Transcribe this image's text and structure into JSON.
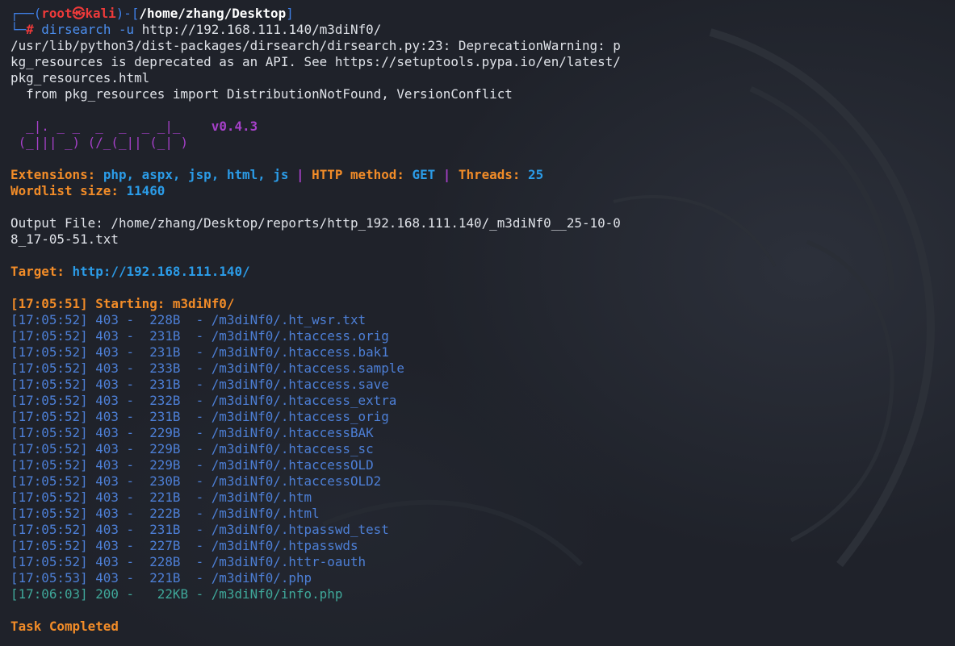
{
  "prompt": {
    "frame_top": "┌──(",
    "user": "root㉿kali",
    "frame_mid": ")-[",
    "cwd": "/home/zhang/Desktop",
    "frame_end": "]",
    "frame_bottom": "└─",
    "hash": "#",
    "command": "dirsearch",
    "args": "-u",
    "url": "http://192.168.111.140/m3diNf0/"
  },
  "warning": {
    "line1": "/usr/lib/python3/dist-packages/dirsearch/dirsearch.py:23: DeprecationWarning: p",
    "line2": "kg_resources is deprecated as an API. See https://setuptools.pypa.io/en/latest/",
    "line3": "pkg_resources.html",
    "line4": "  from pkg_resources import DistributionNotFound, VersionConflict"
  },
  "banner": {
    "art1": "  _|. _ _  _  _  _ _|_    ",
    "version": "v0.4.3",
    "art2": " (_||| _) (/_(_|| (_| )"
  },
  "config": {
    "ext_label": "Extensions: ",
    "ext_value": "php, aspx, jsp, html, js",
    "sep1": " | ",
    "method_label": "HTTP method: ",
    "method_value": "GET",
    "sep2": " | ",
    "threads_label": "Threads: ",
    "threads_value": "25",
    "wordlist_label": "Wordlist size: ",
    "wordlist_value": "11460"
  },
  "output": {
    "line1": "Output File: /home/zhang/Desktop/reports/http_192.168.111.140/_m3diNf0__25-10-0",
    "line2": "8_17-05-51.txt"
  },
  "target": {
    "label": "Target: ",
    "value": "http://192.168.111.140/"
  },
  "start": {
    "text": "[17:05:51] Starting: m3diNf0/"
  },
  "results": [
    "[17:05:52] 403 -  228B  - /m3diNf0/.ht_wsr.txt",
    "[17:05:52] 403 -  231B  - /m3diNf0/.htaccess.orig",
    "[17:05:52] 403 -  231B  - /m3diNf0/.htaccess.bak1",
    "[17:05:52] 403 -  233B  - /m3diNf0/.htaccess.sample",
    "[17:05:52] 403 -  231B  - /m3diNf0/.htaccess.save",
    "[17:05:52] 403 -  232B  - /m3diNf0/.htaccess_extra",
    "[17:05:52] 403 -  231B  - /m3diNf0/.htaccess_orig",
    "[17:05:52] 403 -  229B  - /m3diNf0/.htaccessBAK",
    "[17:05:52] 403 -  229B  - /m3diNf0/.htaccess_sc",
    "[17:05:52] 403 -  229B  - /m3diNf0/.htaccessOLD",
    "[17:05:52] 403 -  230B  - /m3diNf0/.htaccessOLD2",
    "[17:05:52] 403 -  221B  - /m3diNf0/.htm",
    "[17:05:52] 403 -  222B  - /m3diNf0/.html",
    "[17:05:52] 403 -  231B  - /m3diNf0/.htpasswd_test",
    "[17:05:52] 403 -  227B  - /m3diNf0/.htpasswds",
    "[17:05:52] 403 -  228B  - /m3diNf0/.httr-oauth",
    "[17:05:53] 403 -  221B  - /m3diNf0/.php"
  ],
  "success": {
    "text": "[17:06:03] 200 -   22KB - /m3diNf0/info.php"
  },
  "footer": {
    "text": "Task Completed"
  },
  "colors": {
    "background": "#1f222a",
    "prompt_frame": "#3f7fe6",
    "prompt_user": "#ef3a3a",
    "orange": "#f28c28",
    "cyan": "#2b9ce8",
    "purple": "#a540c8",
    "result_403": "#4d7fd6",
    "result_200": "#3fa89a"
  }
}
